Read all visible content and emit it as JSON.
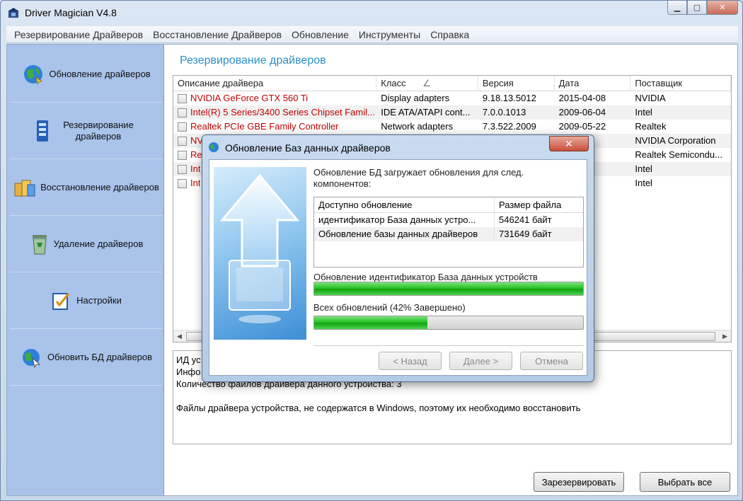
{
  "window": {
    "title": "Driver Magician V4.8"
  },
  "menu": [
    "Резервирование Драйверов",
    "Восстановление Драйверов",
    "Обновление",
    "Инструменты",
    "Справка"
  ],
  "sidebar": {
    "items": [
      {
        "label": "Обновление драйверов",
        "icon": "globe-icon"
      },
      {
        "label": "Резервирование драйверов",
        "icon": "backup-icon"
      },
      {
        "label": "Восстановление драйверов",
        "icon": "restore-icon"
      },
      {
        "label": "Удаление драйверов",
        "icon": "recycle-icon"
      },
      {
        "label": "Настройки",
        "icon": "settings-icon"
      },
      {
        "label": "Обновить БД драйверов",
        "icon": "update-db-icon"
      }
    ]
  },
  "main": {
    "section_title": "Резервирование драйверов",
    "columns": [
      "Описание драйвера",
      "Класс",
      "Версия",
      "Дата",
      "Поставщик"
    ],
    "sort_indicator": "∠",
    "rows": [
      {
        "name": "NVIDIA GeForce GTX 560 Ti",
        "class": "Display adapters",
        "version": "9.18.13.5012",
        "date": "2015-04-08",
        "vendor": "NVIDIA"
      },
      {
        "name": "Intel(R) 5 Series/3400 Series Chipset Famil...",
        "class": "IDE ATA/ATAPI cont...",
        "version": "7.0.0.1013",
        "date": "2009-06-04",
        "vendor": "Intel"
      },
      {
        "name": "Realtek PCIe GBE Family Controller",
        "class": "Network adapters",
        "version": "7.3.522.2009",
        "date": "2009-05-22",
        "vendor": "Realtek"
      },
      {
        "name": "NV",
        "class": "",
        "version": "",
        "date": "09",
        "vendor": "NVIDIA Corporation"
      },
      {
        "name": "Re",
        "class": "",
        "version": "",
        "date": "03",
        "vendor": "Realtek Semicondu..."
      },
      {
        "name": "Int",
        "class": "",
        "version": "",
        "date": "28",
        "vendor": "Intel"
      },
      {
        "name": "Int",
        "class": "",
        "version": "",
        "date": "04",
        "vendor": "Intel"
      }
    ],
    "info_lines": [
      "ИД ус",
      "Инфо",
      "Количество файлов драйвера данного устройства: 3",
      "",
      "Файлы драйвера устройства, не содержатся в Windows, поэтому их необходимо восстановить"
    ],
    "backup_button": "Зарезервировать",
    "select_all_button": "Выбрать все"
  },
  "dialog": {
    "title": "Обновление Баз данных драйверов",
    "close_glyph": "✕",
    "message": "Обновление БД загружает обновления для след. компонентов:",
    "columns": [
      "Доступно обновление",
      "Размер файла"
    ],
    "updates": [
      {
        "name": "идентификатор База данных устро...",
        "size": "546241 байт"
      },
      {
        "name": "Обновление базы данных драйверов",
        "size": "731649 байт"
      }
    ],
    "progress1_label": "Обновление идентификатор База данных устройств",
    "progress1_value": 100,
    "progress2_label": "Всех обновлений (42% Завершено)",
    "progress2_value": 42,
    "back_button": "< Назад",
    "next_button": "Далее >",
    "cancel_button": "Отмена"
  }
}
